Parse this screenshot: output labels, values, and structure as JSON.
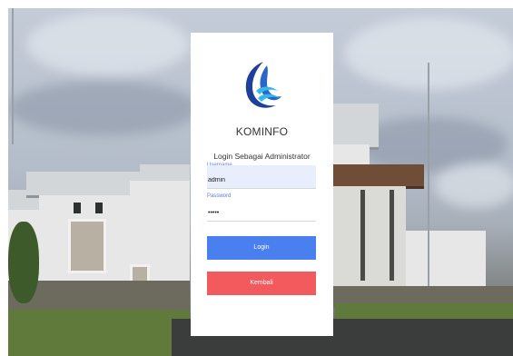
{
  "app_name": "KOMINFO",
  "subtitle": "Login Sebagai Administrator",
  "username": {
    "label": "Username",
    "value": "admin"
  },
  "password": {
    "label": "Password",
    "value": "•••••"
  },
  "buttons": {
    "login": "Login",
    "back": "Kembali"
  },
  "colors": {
    "login_button": "#4a7ff0",
    "back_button": "#f25a5e",
    "field_label": "#5b79e8",
    "field_fill": "#e8eefc",
    "logo_dark_blue": "#1e3f9a",
    "logo_light_blue": "#35b7e8"
  },
  "icons": {
    "logo": "kominfo-logo-icon"
  }
}
